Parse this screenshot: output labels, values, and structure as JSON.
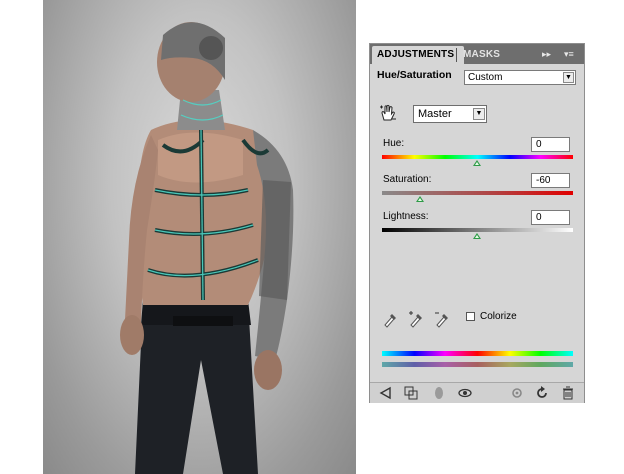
{
  "panel": {
    "tabs": [
      {
        "label": "ADJUSTMENTS",
        "active": true
      },
      {
        "label": "MASKS",
        "active": false
      }
    ],
    "controls": {
      "expand": "▸▸",
      "menu": "▾≡"
    },
    "title": "Hue/Saturation",
    "preset": {
      "value": "Custom"
    },
    "channel": {
      "value": "Master"
    },
    "hue": {
      "label": "Hue:",
      "value": "0",
      "level": 0
    },
    "saturation": {
      "label": "Saturation:",
      "value": "-60",
      "level": -60
    },
    "lightness": {
      "label": "Lightness:",
      "value": "0",
      "level": 0
    },
    "colorize": {
      "label": "Colorize",
      "checked": false
    }
  },
  "icons": {
    "targeted_adjustment": "hand-icon",
    "eyedroppers": [
      "eyedropper-icon",
      "eyedropper-plus-icon",
      "eyedropper-minus-icon"
    ],
    "footer": [
      "back-arrow-icon",
      "clip-to-layer-icon",
      "layer-visibility-toggle-icon",
      "eye-icon",
      "view-previous-state-icon",
      "reset-icon",
      "trash-icon"
    ]
  },
  "colors": {
    "panel": "#d6d6d6",
    "tabbar": "#6e6e6e",
    "slider_thumb": "#2f9a48"
  }
}
